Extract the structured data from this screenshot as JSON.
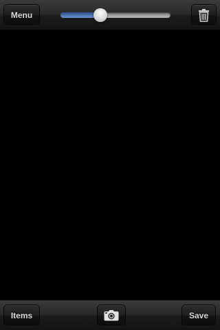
{
  "top_toolbar": {
    "menu_label": "Menu",
    "slider": {
      "value": 0.36
    },
    "trash_icon": "trash-icon"
  },
  "bottom_toolbar": {
    "items_label": "Items",
    "camera_icon": "camera-icon",
    "save_label": "Save"
  },
  "colors": {
    "toolbar": "#2a2a2a",
    "slider_fill": "#4a73b5",
    "background": "#000000"
  }
}
